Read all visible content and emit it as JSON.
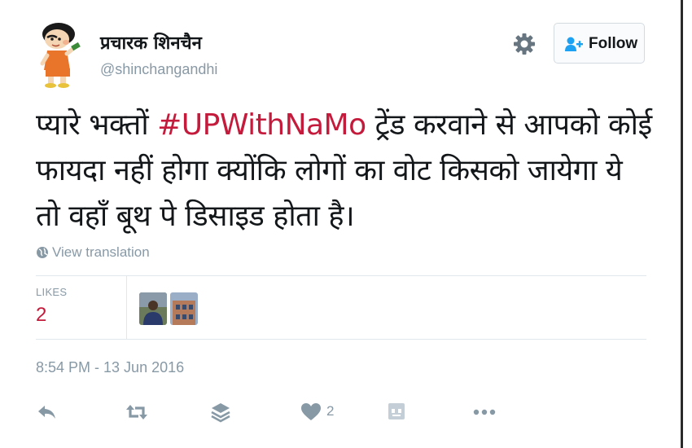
{
  "user": {
    "display_name": "प्रचारक शिनचैन",
    "handle": "@shinchangandhi"
  },
  "follow_button": {
    "label": "Follow"
  },
  "tweet": {
    "text_before": "प्यारे भक्तों ",
    "hashtag": "#UPWithNaMo",
    "text_after": " ट्रेंड करवाने से आपको कोई फायदा नहीं होगा क्योंकि लोगों का वोट किसको जायेगा ये तो वहाँ बूथ पे डिसाइड होता है।",
    "translate_label": "View translation"
  },
  "stats": {
    "likes_label": "LIKES",
    "likes_count": "2"
  },
  "timestamp": "8:54 PM - 13 Jun 2016",
  "actions": {
    "like_count": "2"
  },
  "colors": {
    "accent_red": "#c41a3b",
    "muted_gray": "#8899a6",
    "border": "#e1e8ed"
  },
  "icons": [
    "gear-icon",
    "follow-person-icon",
    "globe-icon",
    "reply-icon",
    "retweet-icon",
    "layers-icon",
    "heart-icon",
    "app-icon",
    "more-icon"
  ]
}
